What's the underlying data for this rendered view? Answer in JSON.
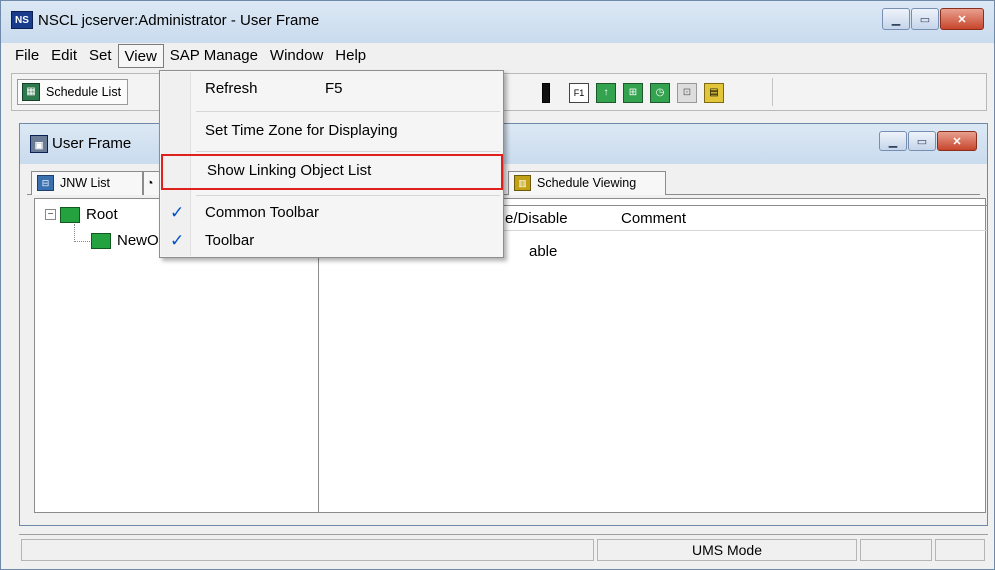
{
  "window": {
    "app_icon": "NS",
    "title": "NSCL jcserver:Administrator - User Frame"
  },
  "menubar": [
    "File",
    "Edit",
    "Set",
    "View",
    "SAP Manage",
    "Window",
    "Help"
  ],
  "toolbar": {
    "schedule_list_label": "Schedule List",
    "f1_icon_label": "F1"
  },
  "child_window": {
    "title": "User Frame",
    "tabs": [
      {
        "label": "JNW List",
        "icon": "network-list-icon"
      },
      {
        "label": "",
        "icon": "clock-icon"
      },
      {
        "label": "Schedule Viewing",
        "icon": "calendar-icon"
      }
    ],
    "tree": {
      "root": "Root",
      "child": "NewO"
    },
    "list_columns": [
      "able/Disable",
      "Comment"
    ],
    "list_row_value": "able"
  },
  "view_menu": {
    "items": [
      {
        "label": "Refresh",
        "shortcut": "F5",
        "checked": false
      },
      {
        "label": "Set Time Zone for Displaying",
        "checked": false
      },
      {
        "label": "Show Linking Object List",
        "checked": false,
        "highlighted": true
      },
      {
        "label": "Common Toolbar",
        "checked": true
      },
      {
        "label": "Toolbar",
        "checked": true
      }
    ],
    "check_glyph": "✓"
  },
  "statusbar": {
    "mode": "UMS Mode"
  },
  "colors": {
    "highlight_border": "#e0201c",
    "check_color": "#0050c8"
  }
}
